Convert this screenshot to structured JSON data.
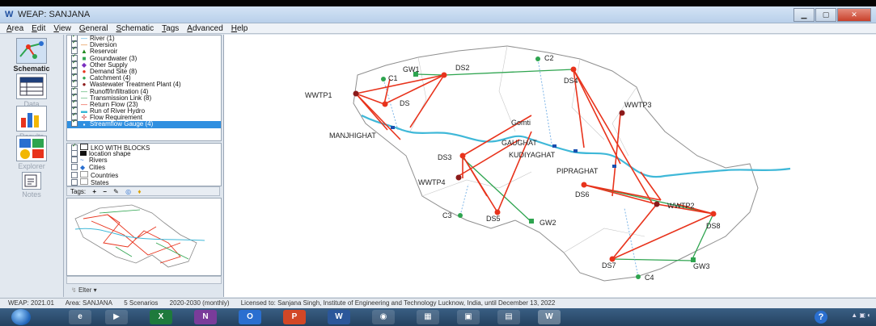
{
  "window": {
    "title": "WEAP: SANJANA",
    "app_icon": "W"
  },
  "menu": [
    "Area",
    "Edit",
    "View",
    "General",
    "Schematic",
    "Tags",
    "Advanced",
    "Help"
  ],
  "views": [
    {
      "label": "Schematic",
      "icon": "schematic-icon"
    },
    {
      "label": "Data",
      "icon": "data-icon"
    },
    {
      "label": "Results",
      "icon": "results-icon"
    },
    {
      "label": "Explorer",
      "icon": "scenario-explorer-icon"
    },
    {
      "label": "Notes",
      "icon": "notes-icon"
    }
  ],
  "legend": [
    {
      "label": "River (1)",
      "symbol": "—",
      "color": "#3fa9e0"
    },
    {
      "label": "Diversion",
      "symbol": "—",
      "color": "#e07a1f"
    },
    {
      "label": "Reservoir",
      "symbol": "▲",
      "color": "#1f8a1f"
    },
    {
      "label": "Groundwater (3)",
      "symbol": "■",
      "color": "#2ea44f"
    },
    {
      "label": "Other Supply",
      "symbol": "◆",
      "color": "#7a2fbf"
    },
    {
      "label": "Demand Site (8)",
      "symbol": "●",
      "color": "#e8331c"
    },
    {
      "label": "Catchment (4)",
      "symbol": "●",
      "color": "#2ea44f"
    },
    {
      "label": "Wastewater Treatment Plant (4)",
      "symbol": "●",
      "color": "#8b1a1a"
    },
    {
      "label": "Runoff/Infiltration (4)",
      "symbol": "—",
      "color": "#2ea44f"
    },
    {
      "label": "Transmission Link (8)",
      "symbol": "—",
      "color": "#2ea44f"
    },
    {
      "label": "Return Flow (23)",
      "symbol": "—",
      "color": "#e8331c"
    },
    {
      "label": "Run of River Hydro",
      "symbol": "▬",
      "color": "#36b7d6"
    },
    {
      "label": "Flow Requirement",
      "symbol": "✢",
      "color": "#cc3333"
    },
    {
      "label": "Streamflow Gauge (4)",
      "symbol": "▪",
      "color": "#1a4fb0"
    }
  ],
  "layers": [
    {
      "label": "LKO WITH BLOCKS",
      "checked": true
    },
    {
      "label": "location shape",
      "checked": false
    },
    {
      "label": "Rivers",
      "checked": false
    },
    {
      "label": "Cities",
      "checked": false
    },
    {
      "label": "Countries",
      "checked": false
    },
    {
      "label": "States",
      "checked": false
    }
  ],
  "tags": {
    "label": "Tags:",
    "buttons": [
      "+",
      "−",
      "✎",
      "◎",
      "♦"
    ]
  },
  "filter": {
    "label": "Elter ▾"
  },
  "status": {
    "version": "WEAP: 2021.01",
    "area": "Area: SANJANA",
    "scenarios": "5 Scenarios",
    "period": "2020-2030 (monthly)",
    "license": "Licensed to: Sanjana Singh, Institute of Engineering and Technology Lucknow, India, until December 13, 2022"
  },
  "map_labels": {
    "wwtp1": "WWTP1",
    "wwtp3": "WWTP3",
    "wwtp4": "WWTP4",
    "wwtp2": "WWTP2",
    "c1": "C1",
    "c2": "C2",
    "c3": "C3",
    "c4": "C4",
    "gw1": "GW1",
    "gw2": "GW2",
    "gw3": "GW3",
    "ds": "DS",
    "ds2": "DS2",
    "ds4": "DS4",
    "ds3": "DS3",
    "ds5": "DS5",
    "ds6": "DS6",
    "ds7": "DS7",
    "ds8": "DS8",
    "manjhighat": "MANJHIGHAT",
    "gomti": "Gomti",
    "gaughat": "GAUGHAT",
    "kudiyaghat": "KUDIYAGHAT",
    "pipraghat": "PIPRAGHAT"
  },
  "colors": {
    "return_flow": "#e8331c",
    "transmission": "#2ea44f",
    "river": "#3fb8d8",
    "wwtp": "#8b1a1a"
  }
}
